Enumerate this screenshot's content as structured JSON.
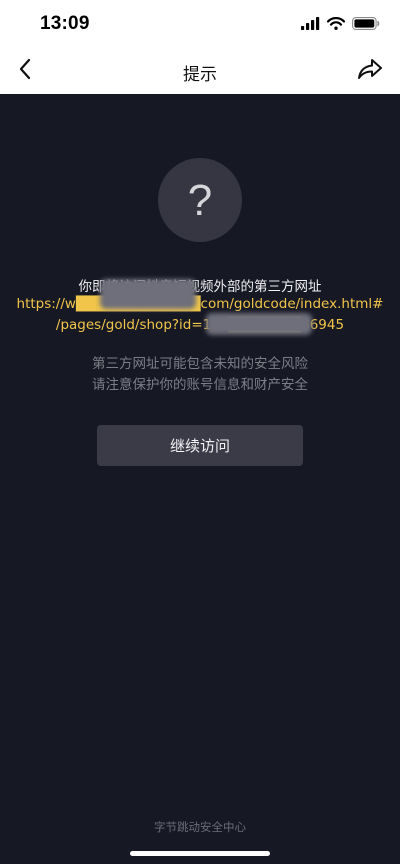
{
  "status_bar": {
    "time": "13:09",
    "icons": [
      "signal-icon",
      "wifi-icon",
      "battery-icon"
    ]
  },
  "nav": {
    "back_icon": "chevron-left-icon",
    "title": "提示",
    "share_icon": "share-icon"
  },
  "main": {
    "help_icon": "help-circle-icon",
    "help_glyph": "?",
    "notice": "你即将访问抖音短视频外部的第三方网址",
    "url_line1": "https://w████████████com/goldcode/index.html#",
    "url_line2": "/pages/gold/shop?id=163███████86945",
    "warning_line1": "第三方网址可能包含未知的安全风险",
    "warning_line2": "请注意保护你的账号信息和财产安全",
    "continue_button": "继续访问"
  },
  "footer": {
    "text": "字节跳动安全中心"
  },
  "colors": {
    "background": "#161824",
    "header": "#ffffff",
    "url": "#f0c54a",
    "button": "#3a3b46"
  }
}
